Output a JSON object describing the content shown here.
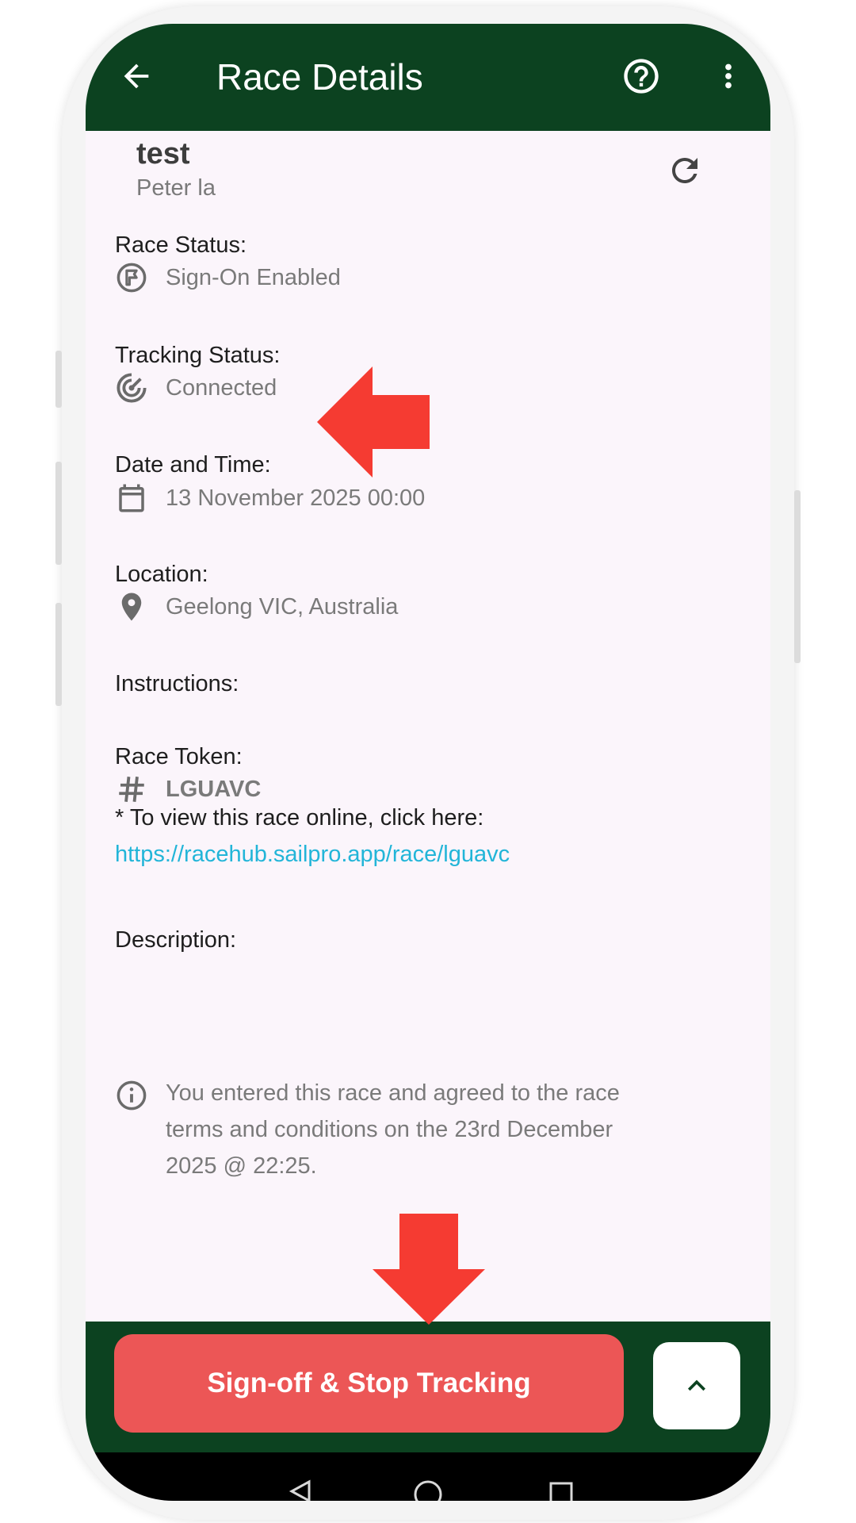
{
  "appbar": {
    "title": "Race Details",
    "back_icon": "arrow-back-icon",
    "help_icon": "help-circle-icon",
    "menu_icon": "more-vert-icon"
  },
  "race": {
    "name": "test",
    "organizer": "Peter la",
    "refresh_icon": "refresh-icon"
  },
  "fields": {
    "race_status": {
      "label": "Race Status:",
      "value": "Sign-On Enabled",
      "icon": "flag-circle-icon"
    },
    "tracking_status": {
      "label": "Tracking Status:",
      "value": "Connected",
      "icon": "radar-icon"
    },
    "date_time": {
      "label": "Date and Time:",
      "value": "13 November 2025 00:00",
      "icon": "calendar-icon"
    },
    "location": {
      "label": "Location:",
      "value": "Geelong VIC, Australia",
      "icon": "location-pin-icon"
    },
    "instructions": {
      "label": "Instructions:"
    },
    "race_token": {
      "label": "Race Token:",
      "value": "LGUAVC",
      "icon": "hash-icon",
      "online_note": "* To view this race online, click here:",
      "link": "https://racehub.sailpro.app/race/lguavc"
    },
    "description": {
      "label": "Description:"
    }
  },
  "agreement": {
    "icon": "info-icon",
    "line1": "You entered this race and agreed to the race",
    "line2": "terms and conditions on the 23rd December",
    "line3": "2025 @ 22:25."
  },
  "bottom": {
    "primary_button": "Sign-off & Stop Tracking",
    "expand_icon": "chevron-up-icon"
  },
  "annotations": {
    "arrow1": "red-arrow-left-annotation",
    "arrow2": "red-arrow-down-annotation"
  },
  "colors": {
    "appbar": "#0c4220",
    "background": "#fbf5fb",
    "button": "#ec5656",
    "link": "#22b5d8",
    "annotation": "#f53b32"
  }
}
